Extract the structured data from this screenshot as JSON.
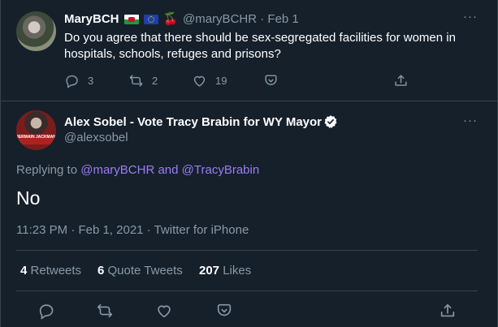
{
  "parent_tweet": {
    "author_name": "MaryBCH",
    "emoji_icons": [
      "wales-flag-icon",
      "eu-flag-icon",
      "cherries-icon"
    ],
    "handle": "@maryBCHR",
    "separator": "·",
    "date": "Feb 1",
    "text": "Do you agree that there should be sex-segregated facilities for women in hospitals, schools, refuges and prisons?",
    "replies": "3",
    "retweets": "2",
    "likes": "19"
  },
  "main_tweet": {
    "author_name": "Alex Sobel - Vote Tracy Brabin for WY Mayor",
    "handle": "@alexsobel",
    "avatar_text": "JERMAIN JACKMAN",
    "replying_prefix": "Replying to",
    "reply_to_1": "@maryBCHR",
    "reply_and": "and",
    "reply_to_2": "@TracyBrabin",
    "text": "No",
    "time": "11:23 PM",
    "date": "Feb 1, 2021",
    "source": "Twitter for iPhone",
    "dot": "·"
  },
  "stats": {
    "retweets_count": "4",
    "retweets_label": "Retweets",
    "quotes_count": "6",
    "quotes_label": "Quote Tweets",
    "likes_count": "207",
    "likes_label": "Likes"
  },
  "more_label": "···",
  "colors": {
    "background": "#15202b",
    "secondary_text": "#8899a6",
    "link": "#9d7cf5",
    "divider": "#38444d"
  }
}
